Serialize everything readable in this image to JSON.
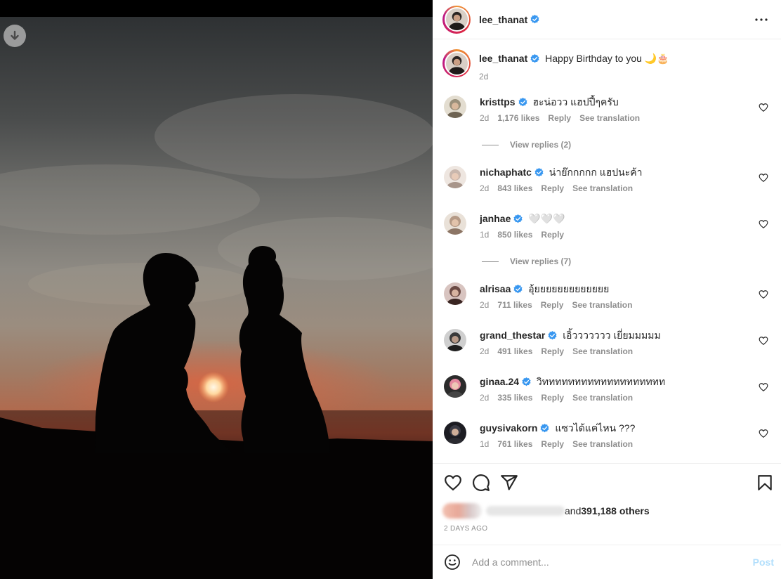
{
  "header": {
    "username": "lee_thanat",
    "more_icon": "more-horizontal-icon"
  },
  "caption": {
    "username": "lee_thanat",
    "text": "Happy Birthday to you 🌙🎂",
    "time": "2d"
  },
  "comments": [
    {
      "username": "kristtps",
      "text": "ฮะน่อวว แฮปปี้ๆครับ",
      "time": "2d",
      "likes": "1,176 likes",
      "reply": "Reply",
      "translate": "See translation",
      "avatar_color": "#9a8f7a"
    },
    {
      "username": "nichaphatc",
      "text": "น่าย๊กกกกก แฮปนะค้า",
      "time": "2d",
      "likes": "843 likes",
      "reply": "Reply",
      "translate": "See translation",
      "avatar_color": "#c9b7ad"
    },
    {
      "username": "janhae",
      "text": "🤍🤍🤍",
      "time": "1d",
      "likes": "850 likes",
      "reply": "Reply",
      "translate": "",
      "avatar_color": "#b59a86"
    },
    {
      "username": "alrisaa",
      "text": "อุ้ยยยยยยยยยยยยย",
      "time": "2d",
      "likes": "711 likes",
      "reply": "Reply",
      "translate": "See translation",
      "avatar_color": "#6b4a44"
    },
    {
      "username": "grand_thestar",
      "text": "เอิ้ววววววว เยี่ยมมมมม",
      "time": "2d",
      "likes": "491 likes",
      "reply": "Reply",
      "translate": "See translation",
      "avatar_color": "#3a3a3a"
    },
    {
      "username": "ginaa.24",
      "text": "วิททททททททททททททททททท",
      "time": "2d",
      "likes": "335 likes",
      "reply": "Reply",
      "translate": "See translation",
      "avatar_color": "#d67a8f"
    },
    {
      "username": "guysivakorn",
      "text": "แซวได้แค่ไหน ???",
      "time": "1d",
      "likes": "761 likes",
      "reply": "Reply",
      "translate": "See translation",
      "avatar_color": "#2a2a30"
    }
  ],
  "view_replies": [
    "View replies (2)",
    "View replies (7)"
  ],
  "likes": {
    "and_text": "and ",
    "others": "391,188 others"
  },
  "post_date": "2 DAYS AGO",
  "add_comment": {
    "placeholder": "Add a comment...",
    "post_label": "Post"
  },
  "colors": {
    "verified": "#3897f0",
    "muted": "#8e8e8e",
    "post_disabled": "#b2dffc"
  }
}
